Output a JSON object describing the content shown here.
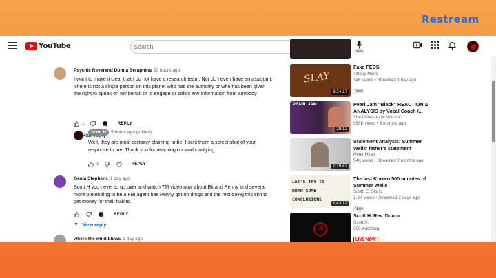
{
  "overlay": {
    "restream_logo": "Restream"
  },
  "header": {
    "logo_text": "YouTube",
    "search_placeholder": "Search"
  },
  "comments": [
    {
      "author": "Psychic Reverend Donna Seraphina",
      "time": "20 hours ago",
      "text": "I want to make it clear that I do not have a research team. Nor do I even have an assistant. There is not a single person on this planet who has the authority or who has been given the right to speak on my behalf or to engage or solicit any information from anybody",
      "likes": "1",
      "reply_label": "REPLY",
      "toggle_label": "Hide reply"
    },
    {
      "author": "Scott H",
      "time": "5 hours ago (edited)",
      "text": "Well, they are most certainly claiming to be! I sent them a screenshot of your response to me. Thank you for reaching out and clarifying.",
      "likes": "1",
      "reply_label": "REPLY"
    },
    {
      "author": "Genia Stephens",
      "time": "1 day ago",
      "text": "Scott H you never to go over and watch TM video now about Bk and Penny and several more pretending to be a FBI  agent has Penny got on drugs and the rest doing this shit to get money for their habits.",
      "likes": "",
      "reply_label": "REPLY",
      "toggle_label": "View reply"
    },
    {
      "author": "where the wind blows",
      "time": "1 day ago"
    }
  ],
  "sidebar": [
    {
      "title": "",
      "channel": "",
      "meta": "",
      "badge": "New",
      "duration": ""
    },
    {
      "title": "Fake FEDS",
      "channel": "Tiffany Marie",
      "meta": "14K views • Streamed 1 day ago",
      "badge": "New",
      "duration": "6:24:37",
      "thumb_text": "SLAY"
    },
    {
      "title": "Pearl Jam \"Black\" REACTION & ANALYSIS by Vocal Coach /...",
      "channel": "The Charismatic Voice",
      "meta": "958K views • 8 months ago",
      "badge": "",
      "duration": "28:12",
      "thumb_text": "PEARL JAM"
    },
    {
      "title": "Statement Analysis: Summer Wells' father's statement",
      "channel": "Peter Hyatt",
      "meta": "54K views • Streamed 7 months ago",
      "badge": "",
      "duration": "1:19:42"
    },
    {
      "title": "The last Known 500 minutes of Summer Wells",
      "channel": "Scott. E. Skullz",
      "meta": "1.3K views • Streamed 2 days ago",
      "badge": "New",
      "duration": "1:43:12",
      "thumb_text": "LET'S TRY TO DRAW SOME CONCLUSIONS"
    },
    {
      "title": "Scott H. Rev. Donna",
      "channel": "Scott H.",
      "meta": "306 watching",
      "badge": "LIVE NOW",
      "duration": ""
    }
  ]
}
